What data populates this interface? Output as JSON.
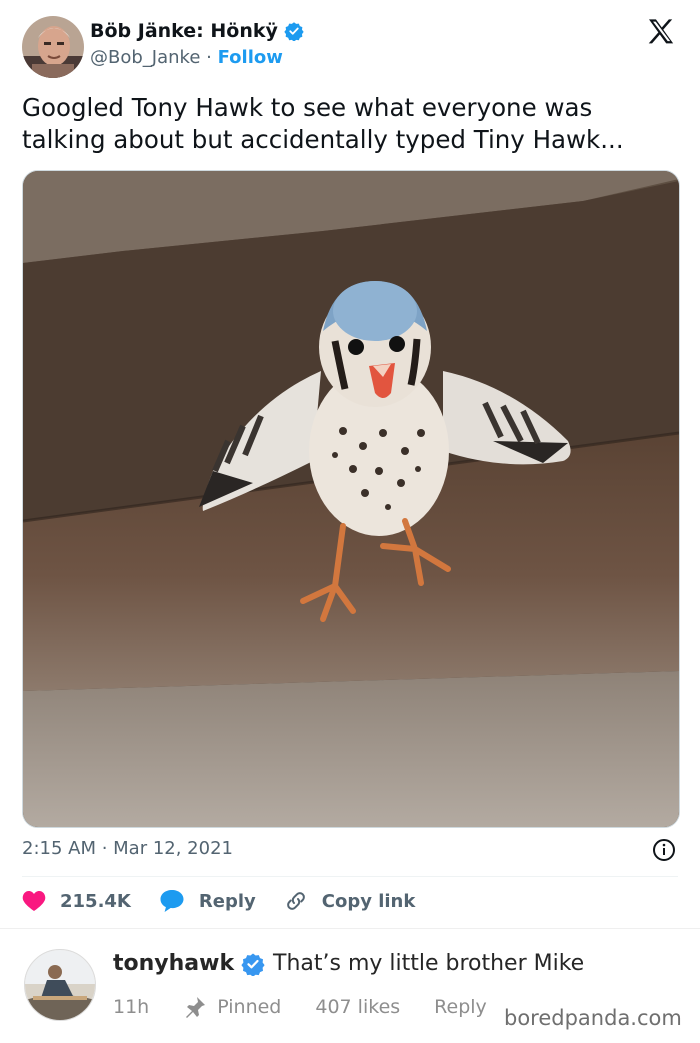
{
  "tweet": {
    "author_name": "Böb Jänke: Hönkÿ",
    "handle": "@Bob_Janke",
    "separator": "·",
    "follow_label": "Follow",
    "text": "Googled Tony Hawk to see what everyone was talking about but accidentally typed Tiny Hawk...",
    "timestamp": "2:15 AM · Mar 12, 2021",
    "likes": "215.4K",
    "reply_label": "Reply",
    "copy_link_label": "Copy link",
    "icons": {
      "verified": "verified-badge-icon",
      "brand": "x-logo-icon",
      "info": "info-icon",
      "like": "heart-icon",
      "reply": "reply-bubble-icon",
      "copy": "link-icon"
    },
    "colors": {
      "accent": "#1d9bf0",
      "heart": "#f91880",
      "text": "#0f1419",
      "muted": "#536471"
    }
  },
  "comment": {
    "username": "tonyhawk",
    "text": "That’s my little brother Mike",
    "age": "11h",
    "pinned_label": "Pinned",
    "likes": "407 likes",
    "reply_label": "Reply"
  },
  "watermark": "boredpanda.com"
}
